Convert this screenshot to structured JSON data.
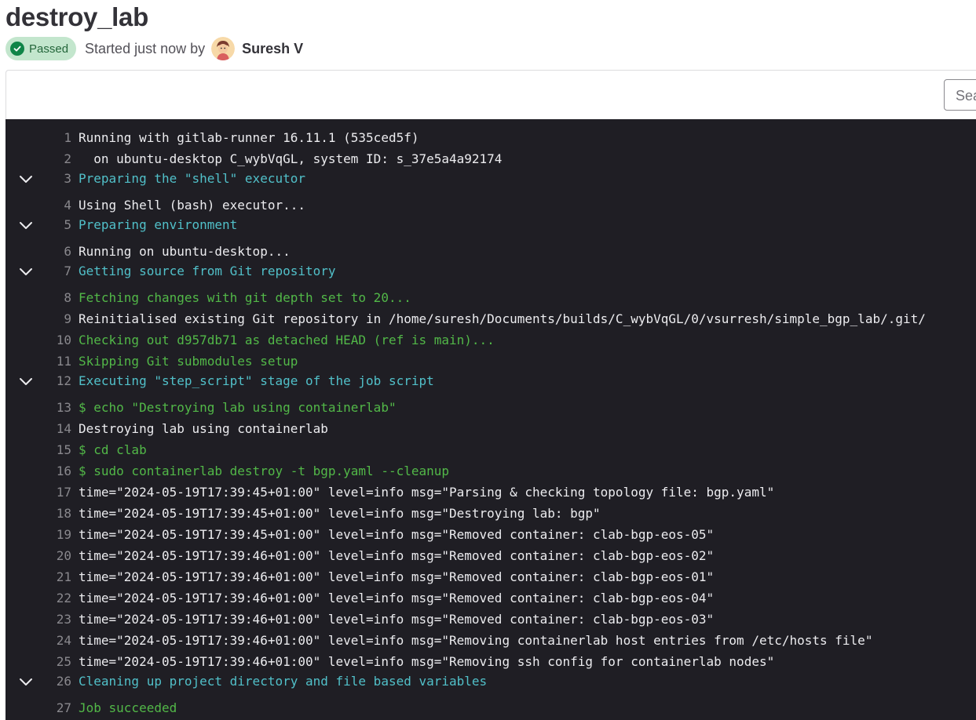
{
  "job": {
    "title": "destroy_lab",
    "status": "Passed",
    "started_text": "Started just now by",
    "author": "Suresh V"
  },
  "search": {
    "placeholder": "Sea"
  },
  "log": [
    {
      "n": "1",
      "text": "Running with gitlab-runner 16.11.1 (535ced5f)",
      "color": "#ececef",
      "section": false
    },
    {
      "n": "2",
      "text": "  on ubuntu-desktop C_wybVqGL, system ID: s_37e5a4a92174",
      "color": "#ececef",
      "section": false
    },
    {
      "n": "3",
      "text": "Preparing the \"shell\" executor",
      "color": "#51c0c9",
      "section": true
    },
    {
      "n": "4",
      "text": "Using Shell (bash) executor...",
      "color": "#ececef",
      "section": false
    },
    {
      "n": "5",
      "text": "Preparing environment",
      "color": "#51c0c9",
      "section": true
    },
    {
      "n": "6",
      "text": "Running on ubuntu-desktop...",
      "color": "#ececef",
      "section": false
    },
    {
      "n": "7",
      "text": "Getting source from Git repository",
      "color": "#51c0c9",
      "section": true
    },
    {
      "n": "8",
      "text": "Fetching changes with git depth set to 20...",
      "color": "#52b848",
      "section": false
    },
    {
      "n": "9",
      "text": "Reinitialised existing Git repository in /home/suresh/Documents/builds/C_wybVqGL/0/vsurresh/simple_bgp_lab/.git/",
      "color": "#ececef",
      "section": false
    },
    {
      "n": "10",
      "text": "Checking out d957db71 as detached HEAD (ref is main)...",
      "color": "#52b848",
      "section": false
    },
    {
      "n": "11",
      "text": "Skipping Git submodules setup",
      "color": "#52b848",
      "section": false
    },
    {
      "n": "12",
      "text": "Executing \"step_script\" stage of the job script",
      "color": "#51c0c9",
      "section": true
    },
    {
      "n": "13",
      "text": "$ echo \"Destroying lab using containerlab\"",
      "color": "#52b848",
      "section": false
    },
    {
      "n": "14",
      "text": "Destroying lab using containerlab",
      "color": "#ececef",
      "section": false
    },
    {
      "n": "15",
      "text": "$ cd clab",
      "color": "#52b848",
      "section": false
    },
    {
      "n": "16",
      "text": "$ sudo containerlab destroy -t bgp.yaml --cleanup",
      "color": "#52b848",
      "section": false
    },
    {
      "n": "17",
      "text": "time=\"2024-05-19T17:39:45+01:00\" level=info msg=\"Parsing & checking topology file: bgp.yaml\"",
      "color": "#ececef",
      "section": false
    },
    {
      "n": "18",
      "text": "time=\"2024-05-19T17:39:45+01:00\" level=info msg=\"Destroying lab: bgp\"",
      "color": "#ececef",
      "section": false
    },
    {
      "n": "19",
      "text": "time=\"2024-05-19T17:39:45+01:00\" level=info msg=\"Removed container: clab-bgp-eos-05\"",
      "color": "#ececef",
      "section": false
    },
    {
      "n": "20",
      "text": "time=\"2024-05-19T17:39:46+01:00\" level=info msg=\"Removed container: clab-bgp-eos-02\"",
      "color": "#ececef",
      "section": false
    },
    {
      "n": "21",
      "text": "time=\"2024-05-19T17:39:46+01:00\" level=info msg=\"Removed container: clab-bgp-eos-01\"",
      "color": "#ececef",
      "section": false
    },
    {
      "n": "22",
      "text": "time=\"2024-05-19T17:39:46+01:00\" level=info msg=\"Removed container: clab-bgp-eos-04\"",
      "color": "#ececef",
      "section": false
    },
    {
      "n": "23",
      "text": "time=\"2024-05-19T17:39:46+01:00\" level=info msg=\"Removed container: clab-bgp-eos-03\"",
      "color": "#ececef",
      "section": false
    },
    {
      "n": "24",
      "text": "time=\"2024-05-19T17:39:46+01:00\" level=info msg=\"Removing containerlab host entries from /etc/hosts file\"",
      "color": "#ececef",
      "section": false
    },
    {
      "n": "25",
      "text": "time=\"2024-05-19T17:39:46+01:00\" level=info msg=\"Removing ssh config for containerlab nodes\"",
      "color": "#ececef",
      "section": false
    },
    {
      "n": "26",
      "text": "Cleaning up project directory and file based variables",
      "color": "#51c0c9",
      "section": true
    },
    {
      "n": "27",
      "text": "Job succeeded",
      "color": "#52b848",
      "section": false
    }
  ]
}
